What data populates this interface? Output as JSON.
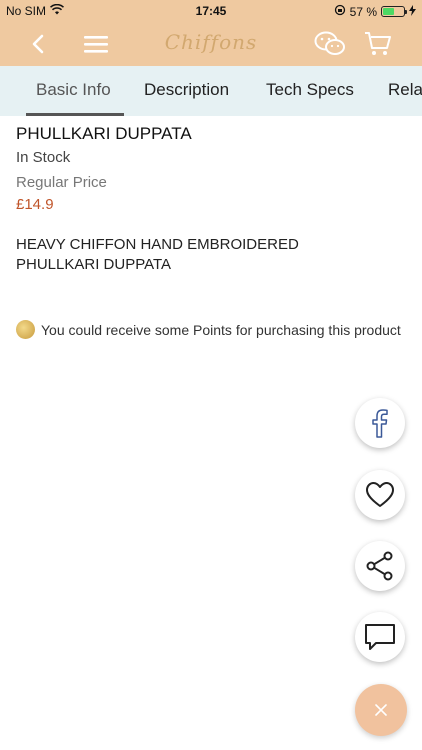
{
  "status": {
    "carrier": "No SIM",
    "time": "17:45",
    "battery_percent": "57 %",
    "battery_level": 0.57
  },
  "navbar": {
    "logo_text": "Chiffons",
    "icons": [
      "back-icon",
      "menu-icon",
      "wechat-icon",
      "cart-icon"
    ]
  },
  "tabs": [
    {
      "label": "Basic Info",
      "active": true
    },
    {
      "label": "Description",
      "active": false
    },
    {
      "label": "Tech Specs",
      "active": false
    },
    {
      "label": "Rela",
      "active": false
    }
  ],
  "product": {
    "name": "PHULLKARI DUPPATA",
    "stock": "In Stock",
    "regular_price_label": "Regular Price",
    "price": "£14.9",
    "description_line1": "HEAVY CHIFFON HAND EMBROIDERED",
    "description_line2": "PHULLKARI DUPPATA"
  },
  "points": {
    "text": "You could receive some Points for purchasing this product"
  },
  "fabs": [
    "facebook-icon",
    "heart-icon",
    "share-icon",
    "comment-icon",
    "close-icon"
  ],
  "colors": {
    "header_bg": "#efc9a0",
    "tab_bg": "#e6f1f3",
    "price": "#c0552a",
    "fab_main": "#f1c29e"
  }
}
